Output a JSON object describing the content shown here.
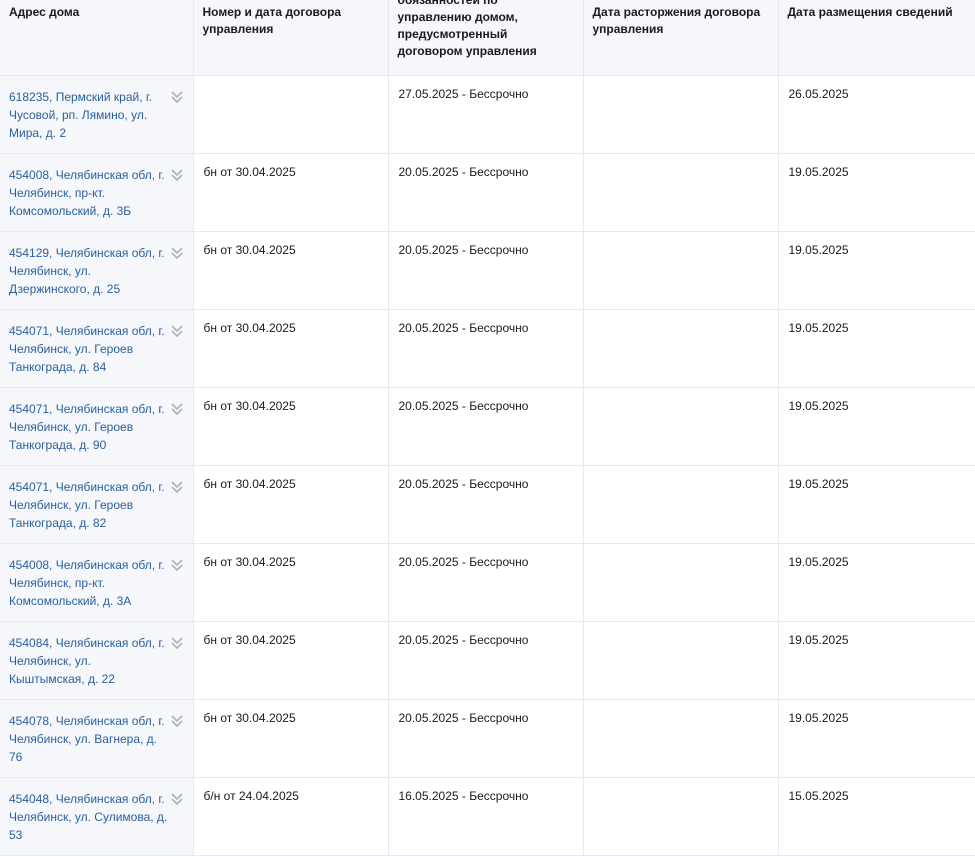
{
  "headers": {
    "address": "Адрес дома",
    "contract": "Номер и дата договора управления",
    "duties": "обязанностей по управлению домом, предусмотренный договором управления",
    "termination": "Дата расторжения договора управления",
    "posted": "Дата размещения сведений"
  },
  "rows": [
    {
      "address": "618235, Пермский край, г. Чусовой, рп. Лямино, ул. Мира, д. 2",
      "contract": "",
      "period": "27.05.2025 - Бессрочно",
      "termination": "",
      "posted": "26.05.2025"
    },
    {
      "address": "454008, Челябинская обл, г. Челябинск, пр-кт. Комсомольский, д. 3Б",
      "contract": "бн от 30.04.2025",
      "period": "20.05.2025 - Бессрочно",
      "termination": "",
      "posted": "19.05.2025"
    },
    {
      "address": "454129, Челябинская обл, г. Челябинск, ул. Дзержинского, д. 25",
      "contract": "бн от 30.04.2025",
      "period": "20.05.2025 - Бессрочно",
      "termination": "",
      "posted": "19.05.2025"
    },
    {
      "address": "454071, Челябинская обл, г. Челябинск, ул. Героев Танкограда, д. 84",
      "contract": "бн от 30.04.2025",
      "period": "20.05.2025 - Бессрочно",
      "termination": "",
      "posted": "19.05.2025"
    },
    {
      "address": "454071, Челябинская обл, г. Челябинск, ул. Героев Танкограда, д. 90",
      "contract": "бн от 30.04.2025",
      "period": "20.05.2025 - Бессрочно",
      "termination": "",
      "posted": "19.05.2025"
    },
    {
      "address": "454071, Челябинская обл, г. Челябинск, ул. Героев Танкограда, д. 82",
      "contract": "бн от 30.04.2025",
      "period": "20.05.2025 - Бессрочно",
      "termination": "",
      "posted": "19.05.2025"
    },
    {
      "address": "454008, Челябинская обл, г. Челябинск, пр-кт. Комсомольский, д. 3А",
      "contract": "бн от 30.04.2025",
      "period": "20.05.2025 - Бессрочно",
      "termination": "",
      "posted": "19.05.2025"
    },
    {
      "address": "454084, Челябинская обл, г. Челябинск, ул. Кыштымская, д. 22",
      "contract": "бн от 30.04.2025",
      "period": "20.05.2025 - Бессрочно",
      "termination": "",
      "posted": "19.05.2025"
    },
    {
      "address": "454078, Челябинская обл, г. Челябинск, ул. Вагнера, д. 76",
      "contract": "бн от 30.04.2025",
      "period": "20.05.2025 - Бессрочно",
      "termination": "",
      "posted": "19.05.2025"
    },
    {
      "address": "454048, Челябинская обл, г. Челябинск, ул. Сулимова, д. 53",
      "contract": "б/н от 24.04.2025",
      "period": "16.05.2025 - Бессрочно",
      "termination": "",
      "posted": "15.05.2025"
    }
  ],
  "icons": {
    "expand": "double-chevron-down-icon"
  },
  "colors": {
    "link": "#2a5f9e",
    "address_bg": "#f5f7fa",
    "header_bg": "#f5f7fa",
    "border": "#e6eaef",
    "icon": "#a9b1ba"
  }
}
